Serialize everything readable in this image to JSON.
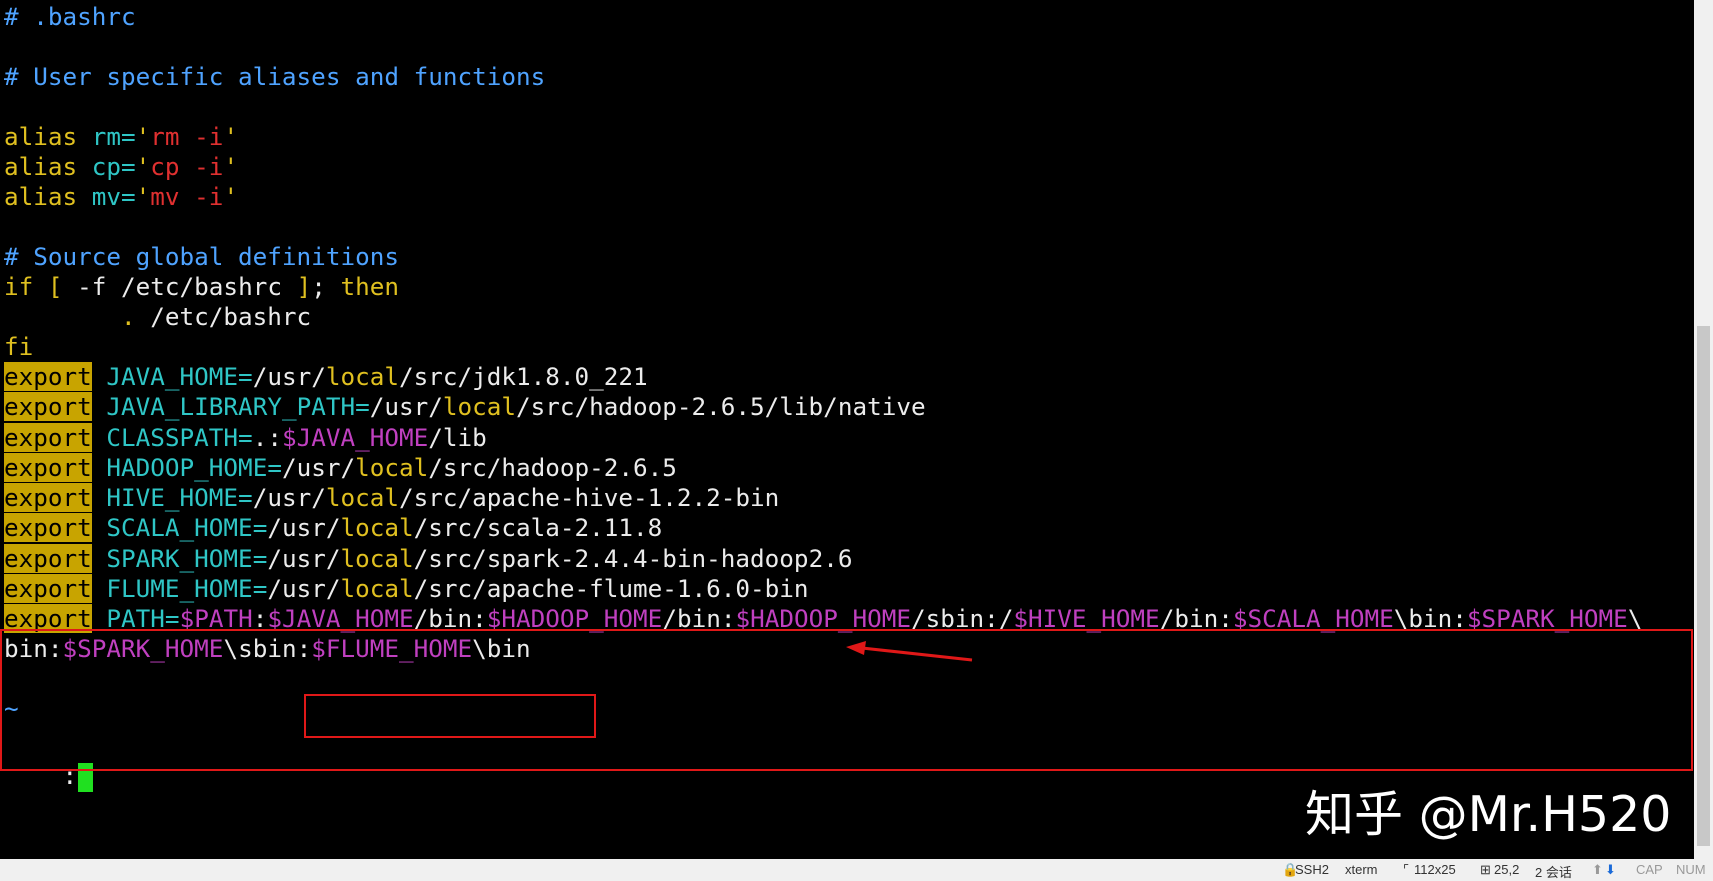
{
  "editor": {
    "lines": [
      {
        "segs": [
          {
            "t": "# .bashrc",
            "c": "comment"
          }
        ]
      },
      {
        "segs": []
      },
      {
        "segs": [
          {
            "t": "# User specific aliases and functions",
            "c": "comment"
          }
        ]
      },
      {
        "segs": []
      },
      {
        "segs": [
          {
            "t": "alias",
            "c": "kw"
          },
          {
            "t": " rm=",
            "c": "cyan"
          },
          {
            "t": "'",
            "c": "kw"
          },
          {
            "t": "rm -i",
            "c": "str"
          },
          {
            "t": "'",
            "c": "kw"
          }
        ]
      },
      {
        "segs": [
          {
            "t": "alias",
            "c": "kw"
          },
          {
            "t": " cp=",
            "c": "cyan"
          },
          {
            "t": "'",
            "c": "kw"
          },
          {
            "t": "cp -i",
            "c": "str"
          },
          {
            "t": "'",
            "c": "kw"
          }
        ]
      },
      {
        "segs": [
          {
            "t": "alias",
            "c": "kw"
          },
          {
            "t": " mv=",
            "c": "cyan"
          },
          {
            "t": "'",
            "c": "kw"
          },
          {
            "t": "mv -i",
            "c": "str"
          },
          {
            "t": "'",
            "c": "kw"
          }
        ]
      },
      {
        "segs": []
      },
      {
        "segs": [
          {
            "t": "# Source global definitions",
            "c": "comment"
          }
        ]
      },
      {
        "segs": [
          {
            "t": "if",
            "c": "kw"
          },
          {
            "t": " [ ",
            "c": "kw"
          },
          {
            "t": "-f /etc/bashrc ",
            "c": "white"
          },
          {
            "t": "]",
            "c": "kw"
          },
          {
            "t": "; ",
            "c": "white"
          },
          {
            "t": "then",
            "c": "kw"
          }
        ]
      },
      {
        "segs": [
          {
            "t": "        . ",
            "c": "kw"
          },
          {
            "t": "/etc/bashrc",
            "c": "white"
          }
        ]
      },
      {
        "segs": [
          {
            "t": "fi",
            "c": "kw"
          }
        ]
      },
      {
        "segs": [
          {
            "t": "export",
            "c": "hl"
          },
          {
            "t": " JAVA_HOME=",
            "c": "cyan"
          },
          {
            "t": "/usr/",
            "c": "white"
          },
          {
            "t": "local",
            "c": "kw"
          },
          {
            "t": "/src/jdk1.8.0_221",
            "c": "white"
          }
        ]
      },
      {
        "segs": [
          {
            "t": "export",
            "c": "hl"
          },
          {
            "t": " JAVA_LIBRARY_PATH=",
            "c": "cyan"
          },
          {
            "t": "/usr/",
            "c": "white"
          },
          {
            "t": "local",
            "c": "kw"
          },
          {
            "t": "/src/hadoop-2.6.5/lib/native",
            "c": "white"
          }
        ]
      },
      {
        "segs": [
          {
            "t": "export",
            "c": "hl"
          },
          {
            "t": " CLASSPATH=",
            "c": "cyan"
          },
          {
            "t": ".:",
            "c": "white"
          },
          {
            "t": "$JAVA_HOME",
            "c": "var"
          },
          {
            "t": "/lib",
            "c": "white"
          }
        ]
      },
      {
        "segs": [
          {
            "t": "export",
            "c": "hl"
          },
          {
            "t": " HADOOP_HOME=",
            "c": "cyan"
          },
          {
            "t": "/usr/",
            "c": "white"
          },
          {
            "t": "local",
            "c": "kw"
          },
          {
            "t": "/src/hadoop-2.6.5",
            "c": "white"
          }
        ]
      },
      {
        "segs": [
          {
            "t": "export",
            "c": "hl"
          },
          {
            "t": " HIVE_HOME=",
            "c": "cyan"
          },
          {
            "t": "/usr/",
            "c": "white"
          },
          {
            "t": "local",
            "c": "kw"
          },
          {
            "t": "/src/apache-hive-1.2.2-bin",
            "c": "white"
          }
        ]
      },
      {
        "segs": [
          {
            "t": "export",
            "c": "hl"
          },
          {
            "t": " SCALA_HOME=",
            "c": "cyan"
          },
          {
            "t": "/usr/",
            "c": "white"
          },
          {
            "t": "local",
            "c": "kw"
          },
          {
            "t": "/src/scala-2.11.8",
            "c": "white"
          }
        ]
      },
      {
        "segs": [
          {
            "t": "export",
            "c": "hl"
          },
          {
            "t": " SPARK_HOME=",
            "c": "cyan"
          },
          {
            "t": "/usr/",
            "c": "white"
          },
          {
            "t": "local",
            "c": "kw"
          },
          {
            "t": "/src/spark-2.4.4-bin-hadoop2.6",
            "c": "white"
          }
        ]
      },
      {
        "segs": [
          {
            "t": "export",
            "c": "hl"
          },
          {
            "t": " FLUME_HOME=",
            "c": "cyan"
          },
          {
            "t": "/usr/",
            "c": "white"
          },
          {
            "t": "local",
            "c": "kw"
          },
          {
            "t": "/src/apache-flume-1.6.0-bin",
            "c": "white"
          }
        ]
      },
      {
        "segs": [
          {
            "t": "export",
            "c": "hl"
          },
          {
            "t": " PATH=",
            "c": "cyan"
          },
          {
            "t": "$PATH",
            "c": "var"
          },
          {
            "t": ":",
            "c": "white"
          },
          {
            "t": "$JAVA_HOME",
            "c": "var"
          },
          {
            "t": "/bin:",
            "c": "white"
          },
          {
            "t": "$HADOOP_HOME",
            "c": "var"
          },
          {
            "t": "/bin:",
            "c": "white"
          },
          {
            "t": "$HADOOP_HOME",
            "c": "var"
          },
          {
            "t": "/sbin:/",
            "c": "white"
          },
          {
            "t": "$HIVE_HOME",
            "c": "var"
          },
          {
            "t": "/bin:",
            "c": "white"
          },
          {
            "t": "$SCALA_HOME",
            "c": "var"
          },
          {
            "t": "\\bin:",
            "c": "white"
          },
          {
            "t": "$SPARK_HOME",
            "c": "var"
          },
          {
            "t": "\\",
            "c": "white"
          }
        ]
      },
      {
        "segs": [
          {
            "t": "bin:",
            "c": "white"
          },
          {
            "t": "$SPARK_HOME",
            "c": "var"
          },
          {
            "t": "\\sbin:",
            "c": "white"
          },
          {
            "t": "$FLUME_HOME",
            "c": "var"
          },
          {
            "t": "\\bin",
            "c": "white"
          }
        ]
      },
      {
        "segs": []
      },
      {
        "segs": [
          {
            "t": "~",
            "c": "comment"
          }
        ]
      }
    ],
    "command_prompt": ":"
  },
  "watermark": "知乎 @Mr.H520",
  "status_bar": {
    "items": [
      "SSH2",
      "xterm",
      "112x25",
      "25,2",
      "2 会话",
      "CAP",
      "NUM"
    ]
  },
  "colors": {
    "comment": "#4fa3ff",
    "keyword": "#e0c020",
    "variable_name": "#2fc6c6",
    "string": "#e03030",
    "shell_variable": "#c040c0",
    "highlight": "#c8a400",
    "cursor": "#20e020",
    "annotation": "#e01818"
  }
}
